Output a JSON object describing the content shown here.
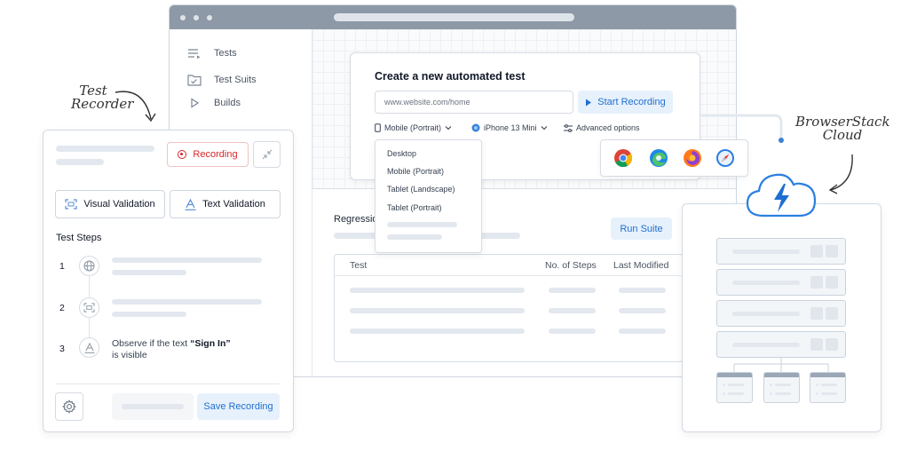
{
  "annotations": {
    "test_recorder_line1": "Test",
    "test_recorder_line2": "Recorder",
    "cloud_line1": "BrowserStack",
    "cloud_line2": "Cloud"
  },
  "sidebar": {
    "items": [
      {
        "label": "Tests",
        "icon": "list-icon"
      },
      {
        "label": "Test Suits",
        "icon": "folder-check-icon"
      },
      {
        "label": "Builds",
        "icon": "play-icon"
      }
    ]
  },
  "create_test": {
    "title": "Create a new automated test",
    "url_placeholder": "www.website.com/home",
    "start_button": "Start Recording",
    "device_select": "Mobile (Portrait)",
    "model_select": "iPhone 13 Mini",
    "advanced": "Advanced options",
    "device_options": [
      "Desktop",
      "Mobile (Portrait)",
      "Tablet (Landscape)",
      "Tablet (Portrait)"
    ],
    "browsers": [
      "chrome-icon",
      "edge-icon",
      "firefox-icon",
      "safari-icon"
    ]
  },
  "regression": {
    "title": "Regressio",
    "run_button": "Run Suite",
    "columns": [
      "Test",
      "No. of Steps",
      "Last Modified"
    ]
  },
  "recorder": {
    "recording_button": "Recording",
    "visual_validation": "Visual Validation",
    "text_validation": "Text Validation",
    "steps_title": "Test Steps",
    "steps": [
      {
        "num": "1",
        "icon": "globe-icon"
      },
      {
        "num": "2",
        "icon": "scan-icon"
      },
      {
        "num": "3",
        "icon": "text-a-icon",
        "text_before": "Observe if the text ",
        "text_bold": "“Sign In”",
        "text_after": "is visible"
      }
    ],
    "save_button": "Save Recording"
  },
  "colors": {
    "accent_blue": "#1f6fd1",
    "accent_blue_bg": "#e7f1fc",
    "recording_red": "#d7262c",
    "titlebar": "#8d99a7"
  }
}
